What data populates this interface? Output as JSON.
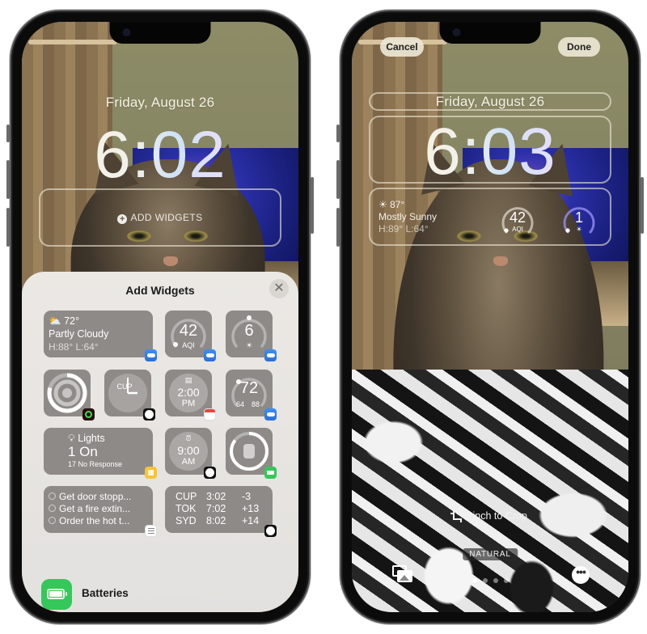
{
  "left_phone": {
    "lock_screen": {
      "date": "Friday, August 26",
      "time": "6:02",
      "add_widgets_button": "ADD WIDGETS"
    },
    "sheet": {
      "title": "Add Widgets",
      "close_icon": "close-icon",
      "widgets": {
        "weather_conditions": {
          "temp": "72°",
          "condition": "Partly Cloudy",
          "hilo": "H:88° L:64°",
          "icon": "partly-cloudy-icon",
          "app": "Weather"
        },
        "air_quality": {
          "value": "42",
          "label": "AQI",
          "fraction": 0.25,
          "app": "Weather"
        },
        "uv_index": {
          "value": "6",
          "label_icon": "sun-icon",
          "fraction": 0.5,
          "app": "Weather"
        },
        "activity_rings": {
          "app": "Fitness",
          "fractions": [
            0.8,
            0.6,
            0.4
          ]
        },
        "world_clock_analog": {
          "city": "CUP",
          "hour": 3,
          "minute": 2,
          "app": "Clock"
        },
        "calendar_next": {
          "icon": "calendar-icon",
          "time": "2:00",
          "ampm": "PM",
          "app": "Calendar"
        },
        "temperature_gauge": {
          "value": "72",
          "low": "64",
          "high": "88",
          "fraction": 0.33,
          "app": "Weather"
        },
        "home_lights": {
          "icon": "lightbulb-icon",
          "title": "Lights",
          "status": "1 On",
          "sub": "17 No Response",
          "app": "Home"
        },
        "alarm": {
          "icon": "alarm-icon",
          "time": "9:00",
          "ampm": "AM",
          "app": "Clock"
        },
        "watch_battery": {
          "icon": "watch-icon",
          "fraction": 0.85,
          "app": "Batteries"
        },
        "reminders": {
          "items": [
            "Get door stopp...",
            "Get a fire extin...",
            "Order the hot t..."
          ],
          "app": "Reminders"
        },
        "world_clock_list": {
          "rows": [
            {
              "city": "CUP",
              "time": "3:02",
              "offset": "-3"
            },
            {
              "city": "TOK",
              "time": "7:02",
              "offset": "+13"
            },
            {
              "city": "SYD",
              "time": "8:02",
              "offset": "+14"
            }
          ],
          "app": "Clock"
        }
      },
      "app_list": [
        {
          "name": "Batteries",
          "icon": "battery-icon"
        }
      ]
    }
  },
  "right_phone": {
    "cancel_button": "Cancel",
    "done_button": "Done",
    "date": "Friday, August 26",
    "time": "6:03",
    "widgets": {
      "weather": {
        "temp": "87°",
        "condition": "Mostly Sunny",
        "hilo": "H:89° L:64°",
        "icon": "sun-icon"
      },
      "aqi": {
        "value": "42",
        "label": "AQI",
        "fraction": 0.25
      },
      "uv": {
        "value": "1",
        "label_icon": "sun-icon",
        "fraction": 0.1
      }
    },
    "pinch_hint": "Pinch to Crop",
    "filter_label": "NATURAL",
    "page_dots": {
      "count": 4,
      "active": 0
    },
    "photos_icon": "photo-library-icon",
    "more_icon": "ellipsis-icon"
  },
  "colors": {
    "sheet_bg": "#e8e5e2",
    "widget_bg": "#8e8a87",
    "batteries_green": "#34c759",
    "weather_blue": "#3f8ef2",
    "home_yellow": "#f4c43c",
    "calendar_red": "#e8453c",
    "uv_purple": "#8a7ee8"
  }
}
